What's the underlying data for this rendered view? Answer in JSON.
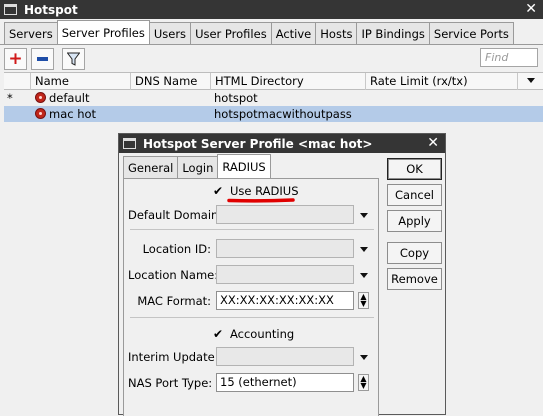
{
  "window": {
    "title": "Hotspot",
    "close": "✕"
  },
  "tabs": [
    "Servers",
    "Server Profiles",
    "Users",
    "User Profiles",
    "Active",
    "Hosts",
    "IP Bindings",
    "Service Ports"
  ],
  "toolbar": {
    "add": "+",
    "remove": "−",
    "filter": "▼"
  },
  "find_placeholder": "Find",
  "table": {
    "headers": [
      "Name",
      "DNS Name",
      "HTML Directory",
      "Rate Limit (rx/tx)"
    ],
    "rows": [
      {
        "marker": "*",
        "name": "default",
        "dns": "",
        "html": "hotspot",
        "rate": ""
      },
      {
        "marker": "",
        "name": "mac hot",
        "dns": "",
        "html": "hotspotmacwithoutpass",
        "rate": ""
      }
    ]
  },
  "dialog": {
    "title": "Hotspot Server Profile <mac hot>",
    "close": "✕",
    "tabs": [
      "General",
      "Login",
      "RADIUS"
    ],
    "use_radius": {
      "label": "Use RADIUS",
      "checked": true
    },
    "default_domain": {
      "label": "Default Domain:",
      "value": ""
    },
    "location_id": {
      "label": "Location ID:",
      "value": ""
    },
    "location_name": {
      "label": "Location Name:",
      "value": ""
    },
    "mac_format": {
      "label": "MAC Format:",
      "value": "XX:XX:XX:XX:XX:XX"
    },
    "accounting": {
      "label": "Accounting",
      "checked": true
    },
    "interim_update": {
      "label": "Interim Update:",
      "value": ""
    },
    "nas_port_type": {
      "label": "NAS Port Type:",
      "value": "15 (ethernet)"
    },
    "buttons": {
      "ok": "OK",
      "cancel": "Cancel",
      "apply": "Apply",
      "copy": "Copy",
      "remove": "Remove"
    },
    "check_glyph": "✔"
  },
  "colors": {
    "titlebar": "#353535",
    "selected_row": "#b4cbe8",
    "highlight": "#e00000",
    "remove_icon": "#1f4ea8",
    "add_icon": "#d01818"
  }
}
